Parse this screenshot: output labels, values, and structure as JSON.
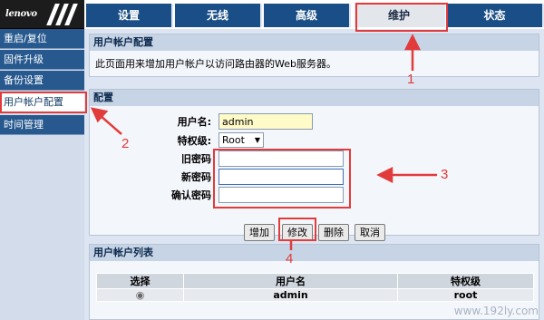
{
  "brand": {
    "logo_text": "lenovo"
  },
  "topnav": {
    "tabs": [
      "设置",
      "无线",
      "高级",
      "维护",
      "状态"
    ],
    "active": "维护"
  },
  "sidebar": {
    "items": [
      "重启/复位",
      "固件升级",
      "备份设置",
      "用户帐户配置",
      "时间管理"
    ],
    "active": "用户帐户配置"
  },
  "account_config": {
    "title": "用户帐户配置",
    "description": "此页面用来增加用户帐户以访问路由器的Web服务器。"
  },
  "config": {
    "title": "配置",
    "username_label": "用户名:",
    "username_value": "admin",
    "privilege_label": "特权级:",
    "privilege_value": "Root",
    "old_password_label": "旧密码",
    "new_password_label": "新密码",
    "confirm_password_label": "确认密码"
  },
  "buttons": {
    "add": "增加",
    "modify": "修改",
    "delete": "删除",
    "cancel": "取消"
  },
  "user_list": {
    "title": "用户帐户列表",
    "columns": [
      "选择",
      "用户名",
      "特权级"
    ],
    "rows": [
      {
        "select": "◉",
        "username": "admin",
        "privilege": "root"
      }
    ]
  },
  "annotations": {
    "labels": [
      "1",
      "2",
      "3",
      "4"
    ],
    "color": "#e23b3b"
  },
  "watermark": "www.192ly.com"
}
